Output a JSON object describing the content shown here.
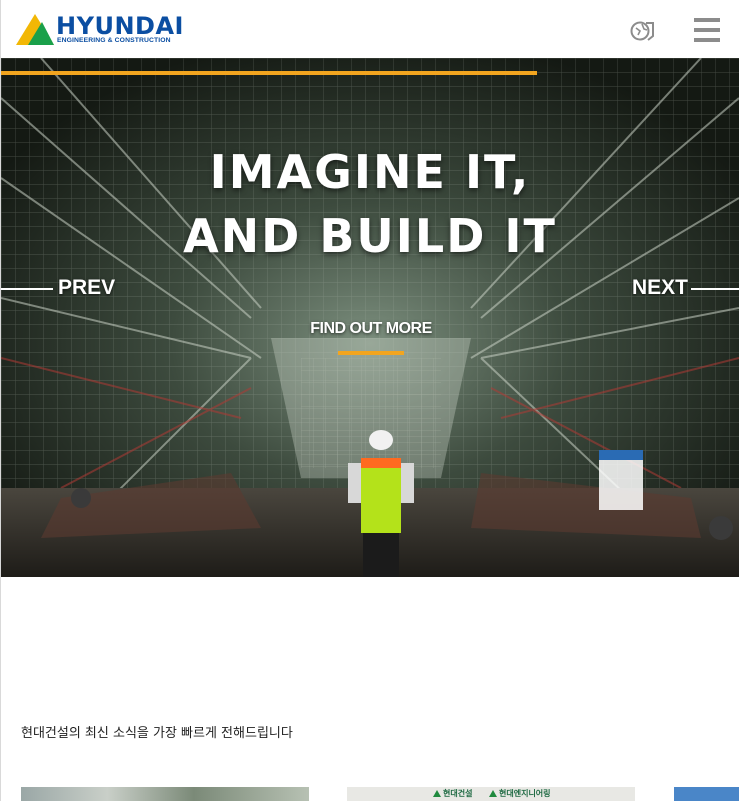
{
  "header": {
    "logo": {
      "wordmark": "HYUNDAI",
      "subtitle": "ENGINEERING & CONSTRUCTION",
      "icon": "hyundai-triangle-logo"
    },
    "globe_icon": "globe-icon",
    "menu_icon": "hamburger-menu-icon"
  },
  "hero": {
    "title_line1": "IMAGINE IT,",
    "title_line2": "AND BUILD IT",
    "prev_label": "PREV",
    "next_label": "NEXT",
    "cta_label": "FIND OUT MORE",
    "accent_color": "#f2a51f"
  },
  "news": {
    "caption": "현대건설의 최신 소식을 가장 빠르게 전해드립니다",
    "cards": [
      {
        "kind": "photo"
      },
      {
        "kind": "photo",
        "banner": [
          "현대건설",
          "현대엔지니어링"
        ]
      },
      {
        "kind": "photo"
      }
    ]
  },
  "colors": {
    "brand_blue": "#0b4ea2",
    "brand_green": "#1aa04a",
    "brand_yellow": "#f2b705",
    "accent": "#f2a51f"
  }
}
